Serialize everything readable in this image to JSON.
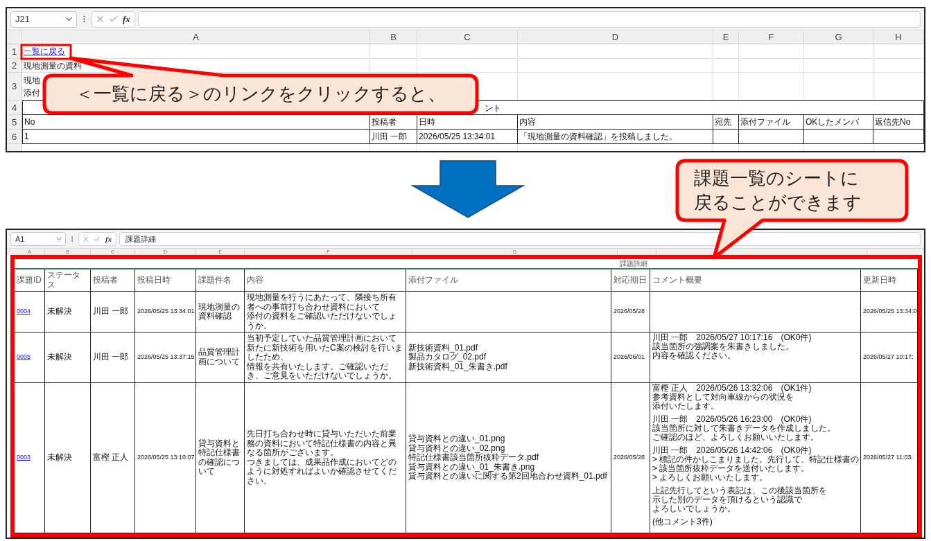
{
  "top_sheet": {
    "name_box": "J21",
    "function_label": "fx",
    "columns": [
      "A",
      "B",
      "C",
      "D",
      "E",
      "F",
      "G",
      "H"
    ],
    "rows": [
      {
        "number": "1",
        "kind": "link",
        "cells": [
          [
            "一覧に戻る"
          ]
        ]
      },
      {
        "number": "2",
        "kind": "plain",
        "cells": [
          [
            "現地測量の資料"
          ]
        ]
      },
      {
        "number": "3",
        "kind": "plain",
        "cells": [
          [
            "現地",
            "添付"
          ]
        ]
      },
      {
        "number": "4",
        "kind": "merged",
        "cells": [
          [
            "ント"
          ]
        ]
      },
      {
        "number": "5",
        "kind": "table",
        "cells": [
          [
            "No"
          ],
          [
            "投稿者"
          ],
          [
            "日時"
          ],
          [
            "内容"
          ],
          [
            "宛先"
          ],
          [
            "添付ファイル"
          ],
          [
            "OKしたメンバ"
          ],
          [
            "返信先No"
          ]
        ]
      },
      {
        "number": "6",
        "kind": "table",
        "cells": [
          [
            "1"
          ],
          [
            "川田 一郎"
          ],
          [
            "2026/05/25 13:34:01"
          ],
          [
            "「現地測量の資料確認」を投稿しました。"
          ]
        ]
      }
    ]
  },
  "callouts": [
    {
      "text": "＜一覧に戻る＞のリンクをクリックすると、"
    },
    {
      "text": "課題一覧のシートに戻ることができます"
    }
  ],
  "bottom_sheet": {
    "name_box": "A1",
    "function_label": "fx",
    "formula": "課題詳細",
    "column_letters": [
      "A",
      "B",
      "C",
      "D",
      "E",
      "F",
      "G"
    ],
    "title": "課題詳細",
    "headers": [
      "課題ID",
      "ステータス",
      "投稿者",
      "投稿日時",
      "課題件名",
      "内容",
      "添付ファイル",
      "対応期日",
      "コメント概要",
      "更新日時"
    ],
    "rows": [
      {
        "id": "0004",
        "status": "未解決",
        "author": "川田 一郎",
        "posted": "2026/05/25 13:34:01",
        "subject": "現地測量の資料確認",
        "content": [
          "現地測量を行うにあたって、隣接ち所有者への事前打ち合わせ資料において",
          "添付の資料をご確認いただけないでしょうか。"
        ],
        "due": "2026/05/28",
        "updated": "2026/05/25 13:34:0"
      },
      {
        "id": "0005",
        "status": "未解決",
        "author": "川田 一郎",
        "posted": "2026/05/25 13:37:15",
        "subject": "品質管理計画について",
        "content": [
          "当初予定していた品質管理計画において新たに新技術を用いたC案の検討を行いましたため、",
          "情報を共有いたします。ご確認いただき、ご意見をいただけないでしょうか。"
        ],
        "files": [
          "新技術資料_01.pdf",
          "製品カタログ_02.pdf",
          "新技術資料_01_朱書き.pdf"
        ],
        "due": "2026/06/01",
        "comments": [
          [
            "川田 一郎　2026/05/27 10:17:16　(OK0件)",
            "該当箇所の強調案を朱書きしました。",
            "内容を確認ください。"
          ]
        ],
        "updated": "2026/05/27 10:17:"
      },
      {
        "id": "0003",
        "status": "未解決",
        "author": "富樫 正人",
        "posted": "2026/05/25 13:10:07",
        "subject": "貸与資料と特記仕様書の確認について",
        "content": [
          "先日打ち合わせ時に貸与いただいた前業務の資料において特記仕様書の内容と異なる箇所がございます。",
          "つきましては、成果品作成においてどのように対処すればよいか確認させてください。"
        ],
        "files": [
          "貸与資料との違い_01.png",
          "貸与資料との違い_02.png",
          "特記仕様書該当箇所抜粋データ.pdf",
          "貸与資料との違い_01_朱書き.png",
          "貸与資料との違いに関する第2回地合わせ資料_01.pdf"
        ],
        "due": "2026/05/28",
        "comments": [
          [
            "富樫 正人　2026/05/26 13:32:06　(OK1件)",
            "参考資料として対向車線からの状況を",
            "添付いたします。"
          ],
          [
            "川田 一郎　2026/05/26 16:23:00　(OK0件)",
            "該当箇所に対して朱書きデータを作成しました。",
            "ご確認のほど、よろしくお願いいたします。"
          ],
          [
            "川田 一郎　2026/05/26 14:42:06　(OK0件)",
            "> 標記の件かしこまりました。先行して、特記仕様書の",
            "> 該当箇所抜粋データを送付いたします。",
            "> よろしくお願いいたします。"
          ],
          [
            "上記先行してという表記は、この後該当箇所を",
            "示した別のデータを頂けるという認識で",
            "よろしいでしょうか。"
          ],
          [
            "(他コメント3件)"
          ]
        ],
        "updated": "2026/05/27 11:03:"
      }
    ]
  }
}
